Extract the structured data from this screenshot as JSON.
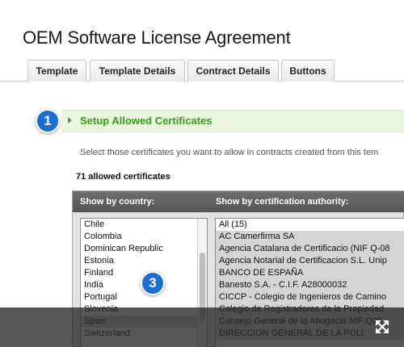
{
  "page": {
    "title": "OEM Software License Agreement"
  },
  "tabs": [
    {
      "label": "Template"
    },
    {
      "label": "Template Details"
    },
    {
      "label": "Contract Details"
    },
    {
      "label": "Buttons"
    }
  ],
  "section": {
    "step_badge": "1",
    "title": "Setup Allowed Certificates",
    "description": "Select those certificates you want to allow in contracts created from this tem",
    "count_label": "71 allowed certificates"
  },
  "filter_panel": {
    "country_header": "Show by country:",
    "authority_header": "Show by certification authority:",
    "countries": [
      "Chile",
      "Colombia",
      "Dominican Republic",
      "Estonia",
      "Finland",
      "India",
      "Portugal",
      "Slovenia",
      "Spain",
      "Switzerland"
    ],
    "selected_country": "Spain",
    "authorities": [
      "All (15)",
      "AC Camerfirma SA",
      "Agencia Catalana de Certificacio (NIF Q-08",
      "Agencia Notarial de Certificacion S.L. Unip",
      "BANCO DE ESPAÑA",
      "Banesto S.A. - C.I.F. A28000032",
      "CICCP - Colegio de Ingenieros de Camino",
      "Colegio de Registradores de la Propiedad",
      "Consejo General de la Abogacia NIF:Q28",
      "DIRECCION GENERAL DE LA POLI"
    ],
    "selected_authorities_from": 1,
    "step_badge": "3"
  },
  "icons": {
    "expand": "expand-icon",
    "section_toggle": "triangle-right-icon"
  },
  "colors": {
    "accent_blue": "#1a6fd6",
    "section_green": "#3a9a1e",
    "section_bg": "#e9f6dd"
  }
}
